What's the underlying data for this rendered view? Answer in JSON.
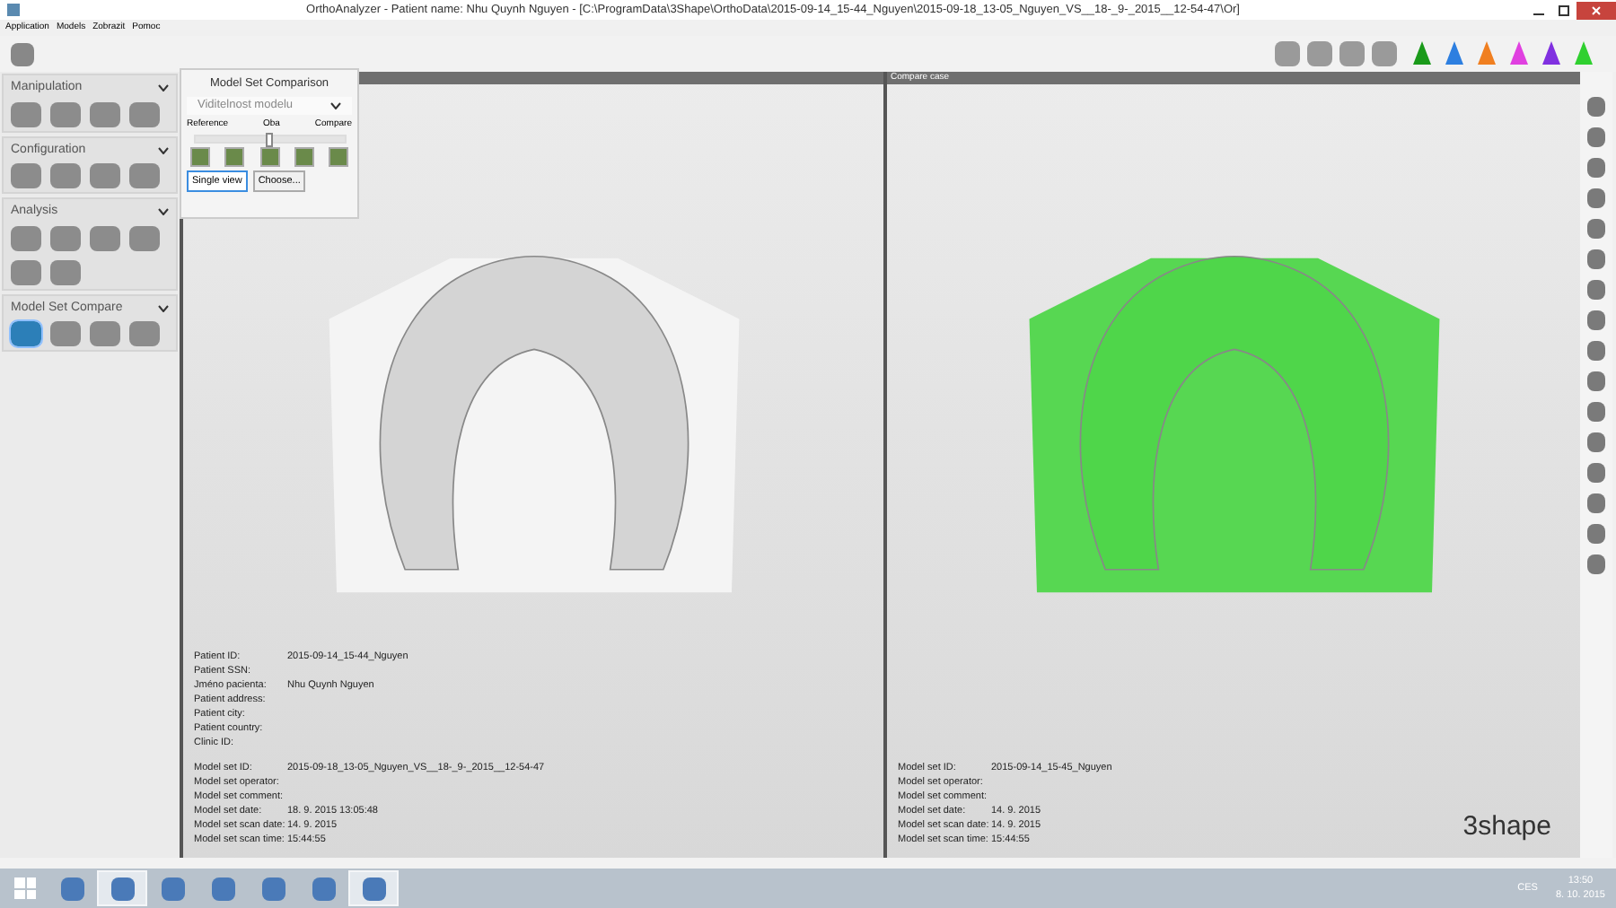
{
  "window": {
    "title": "OrthoAnalyzer - Patient name: Nhu Quynh Nguyen - [C:\\ProgramData\\3Shape\\OrthoData\\2015-09-14_15-44_Nguyen\\2015-09-18_13-05_Nguyen_VS__18-_9-_2015__12-54-47\\Or]"
  },
  "menu": [
    "Application",
    "Models",
    "Zobrazit",
    "Pomoc"
  ],
  "sidebar": {
    "sections": [
      {
        "title": "Manipulation",
        "expanded": true,
        "tools": [
          {
            "selected": false
          },
          {
            "selected": false
          },
          {
            "selected": false
          },
          {
            "selected": false
          }
        ]
      },
      {
        "title": "Configuration",
        "expanded": true,
        "tools": [
          {
            "selected": false
          },
          {
            "selected": false
          },
          {
            "selected": false
          },
          {
            "selected": false
          }
        ]
      },
      {
        "title": "Analysis",
        "expanded": true,
        "tools": [
          {
            "selected": false
          },
          {
            "selected": false
          },
          {
            "selected": false
          },
          {
            "selected": false
          },
          {
            "selected": false
          },
          {
            "selected": false
          }
        ]
      },
      {
        "title": "Model Set Compare",
        "expanded": true,
        "tools": [
          {
            "selected": true
          },
          {
            "selected": false
          },
          {
            "selected": false
          },
          {
            "selected": false
          }
        ]
      }
    ]
  },
  "popup": {
    "title": "Model Set Comparison",
    "dropdown": "Viditelnost modelu",
    "slider_labels": [
      "Reference",
      "Oba",
      "Compare"
    ],
    "slider": {
      "level": 0.5
    },
    "buttons": [
      {
        "label": "Single view",
        "selected": true
      },
      {
        "label": "Choose...",
        "selected": false
      }
    ]
  },
  "viewports": [
    {
      "color": "#d4d4d4",
      "patient": [
        {
          "label": "Patient ID:",
          "value": "2015-09-14_15-44_Nguyen"
        },
        {
          "label": "Patient SSN:"
        },
        {
          "label": "Jméno pacienta:",
          "value": "Nhu Quynh Nguyen"
        },
        {
          "label": "Patient address:"
        },
        {
          "label": "Patient city:"
        },
        {
          "label": "Patient country:"
        },
        {
          "label": "Clinic ID:"
        }
      ],
      "model": [
        {
          "label": "Model set ID:",
          "value": "2015-09-18_13-05_Nguyen_VS__18-_9-_2015__12-54-47"
        },
        {
          "label": "Model set operator:"
        },
        {
          "label": "Model set comment:"
        },
        {
          "label": "Model set date:",
          "value": "18. 9. 2015 13:05:48"
        },
        {
          "label": "Model set scan date:",
          "value": "14. 9. 2015"
        },
        {
          "label": "Model set scan time:",
          "value": "15:44:55"
        }
      ]
    },
    {
      "header": "Compare case",
      "color": "#4fd64a",
      "model": [
        {
          "label": "Model set ID:",
          "value": "2015-09-14_15-45_Nguyen"
        },
        {
          "label": "Model set operator:"
        },
        {
          "label": "Model set comment:"
        },
        {
          "label": "Model set date:",
          "value": "14. 9. 2015"
        },
        {
          "label": "Model set scan date:",
          "value": "14. 9. 2015"
        },
        {
          "label": "Model set scan time:",
          "value": "15:44:55"
        }
      ]
    }
  ],
  "logo": "3shape",
  "taskbar": {
    "apps": [
      {
        "selected": false
      },
      {
        "selected": true
      },
      {
        "selected": false
      },
      {
        "selected": false
      },
      {
        "selected": false
      },
      {
        "selected": false
      },
      {
        "selected": true
      }
    ],
    "language": "CES",
    "time": "13:50",
    "date": "8. 10. 2015"
  }
}
